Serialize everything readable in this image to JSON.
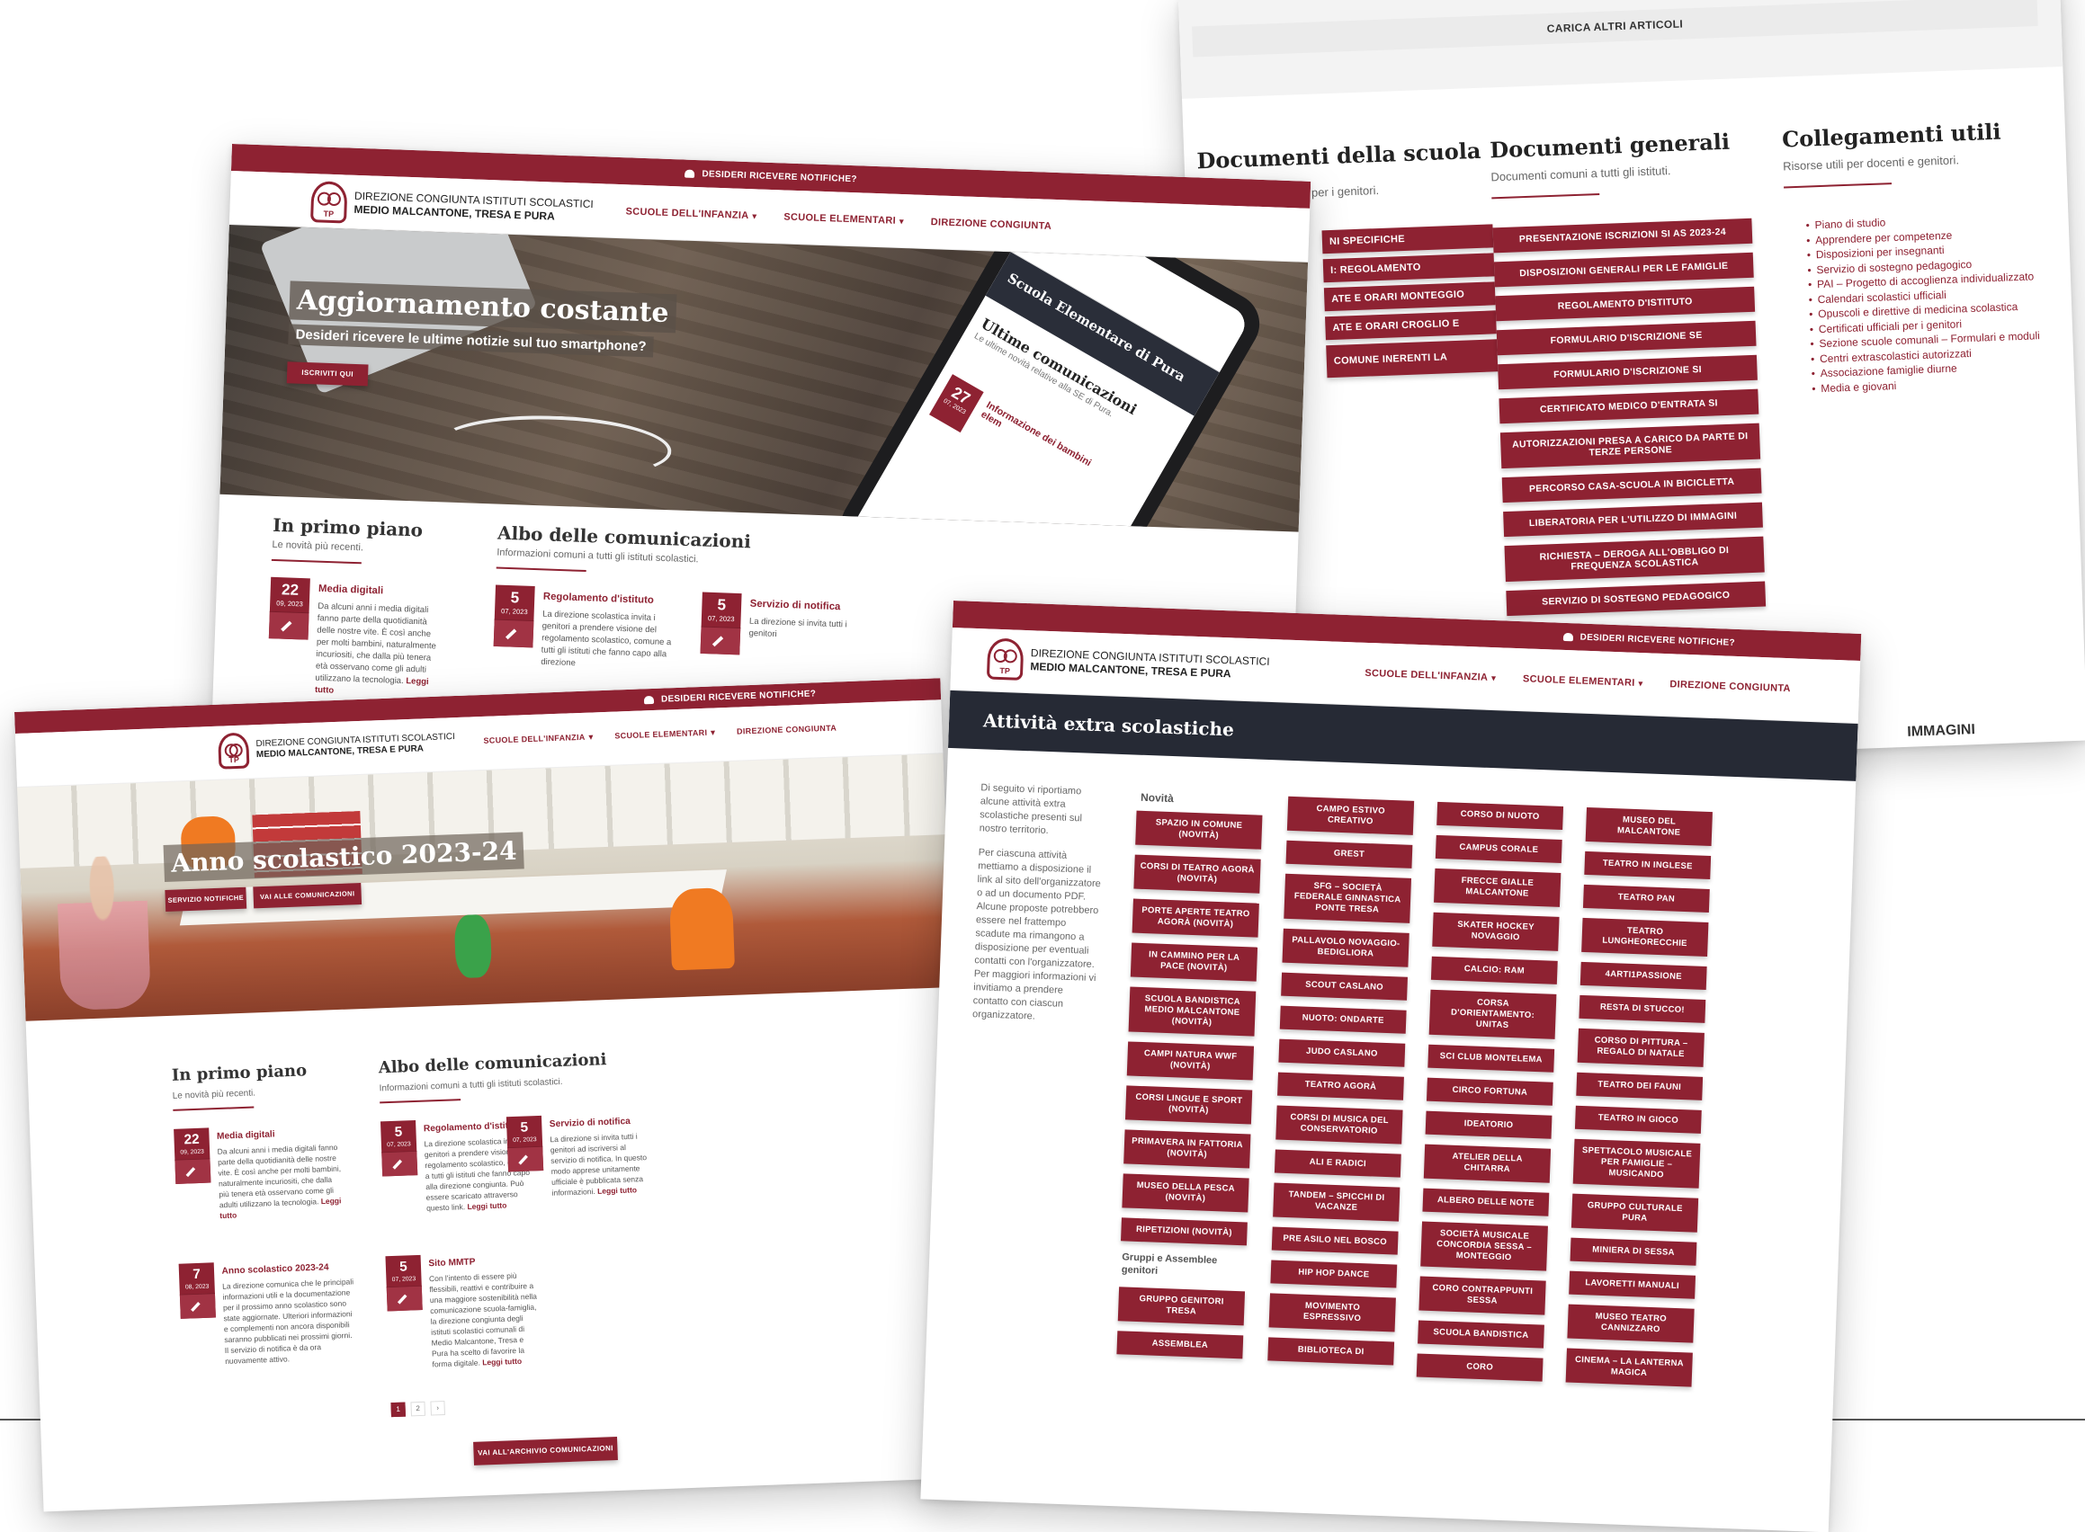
{
  "common": {
    "notify_bar": "DESIDERI RICEVERE NOTIFICHE?",
    "logo_line1": "DIREZIONE CONGIUNTA ISTITUTI SCOLASTICI",
    "logo_line2": "MEDIO MALCANTONE, TRESA E PURA",
    "logo_badge_top": "MM",
    "logo_badge_bottom": "TP",
    "nav": [
      "SCUOLE DELL'INFANZIA",
      "SCUOLE ELEMENTARI",
      "DIREZIONE CONGIUNTA"
    ],
    "chevron": "⌄",
    "brand_color": "#8e2232",
    "dark_header_color": "#262a35"
  },
  "documents_page": {
    "load_more": "CARICA ALTRI ARTICOLI",
    "school_docs": {
      "title": "Documenti della scuola",
      "subtitle": "per i genitori.",
      "buttons": [
        "NI SPECIFICHE",
        "I: REGOLAMENTO",
        "ATE E ORARI MONTEGGIO",
        "ATE E ORARI CROGLIO E",
        "COMUNE INERENTI LA"
      ]
    },
    "general_docs": {
      "title": "Documenti generali",
      "subtitle": "Documenti comuni a tutti gli istituti.",
      "buttons": [
        "PRESENTAZIONE ISCRIZIONI SI AS 2023-24",
        "DISPOSIZIONI GENERALI PER LE FAMIGLIE",
        "REGOLAMENTO D'ISTITUTO",
        "FORMULARIO D'ISCRIZIONE SE",
        "FORMULARIO D'ISCRIZIONE SI",
        "CERTIFICATO MEDICO D'ENTRATA SI",
        "AUTORIZZAZIONI PRESA A CARICO DA PARTE DI TERZE PERSONE",
        "PERCORSO CASA-SCUOLA IN BICICLETTA",
        "LIBERATORIA PER L'UTILIZZO DI IMMAGINI",
        "RICHIESTA – DEROGA ALL'OBBLIGO DI FREQUENZA SCOLASTICA",
        "SERVIZIO DI SOSTEGNO PEDAGOGICO"
      ]
    },
    "useful_links": {
      "title": "Collegamenti utili",
      "subtitle": "Risorse utili per docenti e genitori.",
      "items": [
        "Piano di studio",
        "Apprendere per competenze",
        "Disposizioni per insegnanti",
        "Servizio di sostegno pedagogico",
        "PAI – Progetto di accoglienza individualizzato",
        "Calendari scolastici ufficiali",
        "Opuscoli e direttive di medicina scolastica",
        "Certificati ufficiali per i genitori",
        "Sezione scuole comunali – Formulari e moduli",
        "Centri extrascolastici autorizzati",
        "Associazione famiglie diurne",
        "Media e giovani"
      ]
    },
    "images_label": "IMMAGINI"
  },
  "home_top": {
    "hero_title": "Aggiornamento costante",
    "hero_subtitle": "Desideri ricevere le ultime notizie sul tuo smartphone?",
    "hero_button": "ISCRIVITI QUI",
    "phone": {
      "school": "Scuola Elementare di Pura",
      "heading": "Ultime comunicazioni",
      "sub": "Le ultime novità relative alla SE di Pura.",
      "day": "27",
      "month": "07, 2023",
      "item": "Informazione dei bambini elem"
    },
    "primo_piano": {
      "title": "In primo piano",
      "subtitle": "Le novità più recenti."
    },
    "albo": {
      "title": "Albo delle comunicazioni",
      "subtitle": "Informazioni comuni a tutti gli istituti scolastici."
    },
    "news": [
      {
        "day": "22",
        "month": "09, 2023",
        "title": "Media digitali",
        "body": "Da alcuni anni i media digitali fanno parte della quotidianità delle nostre vite. È così anche per molti bambini, naturalmente incuriositi, che dalla più tenera età osservano come gli adulti utilizzano la tecnologia.",
        "more": "Leggi tutto"
      },
      {
        "day": "5",
        "month": "07, 2023",
        "title": "Regolamento d'istituto",
        "body": "La direzione scolastica invita i genitori a prendere visione del regolamento scolastico, comune a tutti gli istituti che fanno capo alla direzione",
        "more": ""
      },
      {
        "day": "5",
        "month": "07, 2023",
        "title": "Servizio di notifica",
        "body": "La direzione si invita tutti i genitori",
        "more": ""
      }
    ]
  },
  "home_bottom": {
    "hero_title": "Anno scolastico 2023-24",
    "buttons": [
      "SERVIZIO NOTIFICHE",
      "VAI ALLE COMUNICAZIONI"
    ],
    "primo_piano": {
      "title": "In primo piano",
      "subtitle": "Le novità più recenti."
    },
    "albo": {
      "title": "Albo delle comunicazioni",
      "subtitle": "Informazioni comuni a tutti gli istituti scolastici."
    },
    "left_news": [
      {
        "day": "22",
        "month": "09, 2023",
        "title": "Media digitali",
        "body": "Da alcuni anni i media digitali fanno parte della quotidianità delle nostre vite. È così anche per molti bambini, naturalmente incuriositi, che dalla più tenera età osservano come gli adulti utilizzano la tecnologia.",
        "more": "Leggi tutto"
      },
      {
        "day": "7",
        "month": "08, 2023",
        "title": "Anno scolastico 2023-24",
        "body": "La direzione comunica che le principali informazioni utili e la documentazione per il prossimo anno scolastico sono state aggiornate. Ulteriori informazioni e complementi non ancora disponibili saranno pubblicati nei prossimi giorni. Il servizio di notifica è da ora nuovamente attivo.",
        "more": ""
      }
    ],
    "right_news": [
      {
        "day": "5",
        "month": "07, 2023",
        "title": "Regolamento d'istituto",
        "body": "La direzione scolastica invita i genitori a prendere visione del regolamento scolastico, comune a tutti gli istituti che fanno capo alla direzione congiunta. Può essere scaricato attraverso questo link.",
        "more": "Leggi tutto"
      },
      {
        "day": "5",
        "month": "07, 2023",
        "title": "Servizio di notifica",
        "body": "La direzione si invita tutti i genitori ad iscriversi al servizio di notifica. In questo modo apprese unitamente ufficiale è pubblicata senza informazioni.",
        "more": "Leggi tutto"
      },
      {
        "day": "5",
        "month": "07, 2023",
        "title": "Sito MMTP",
        "body": "Con l'intento di essere più flessibili, reattivi e contribuire a una maggiore sostenibilità nella comunicazione scuola-famiglia, la direzione congiunta degli istituti scolastici comunali di Medio Malcantone, Tresa e Pura ha scelto di favorire la forma digitale.",
        "more": "Leggi tutto"
      }
    ],
    "pager": [
      "1",
      "2",
      "›"
    ],
    "archive_button": "VAI ALL'ARCHIVIO COMUNICAZIONI"
  },
  "activities_page": {
    "title": "Attività extra scolastiche",
    "intro_1": "Di seguito vi riportiamo alcune attività extra scolastiche presenti sul nostro territorio.",
    "intro_2": "Per ciascuna attività mettiamo a disposizione il link al sito dell'organizzatore o ad un documento PDF. Alcune proposte potrebbero essere nel frattempo scadute ma rimangono a disposizione per eventuali contatti con l'organizzatore. Per maggiori informazioni vi invitiamo a prendere contatto con ciascun organizzatore.",
    "novita_label": "Novità",
    "groups_label": "Gruppi e Assemblee genitori",
    "col1": [
      "SPAZIO IN COMUNE (NOVITÀ)",
      "CORSI DI TEATRO AGORÀ (NOVITÀ)",
      "PORTE APERTE TEATRO AGORÀ (NOVITÀ)",
      "IN CAMMINO PER LA PACE (NOVITÀ)",
      "SCUOLA BANDISTICA MEDIO MALCANTONE (NOVITÀ)",
      "CAMPI NATURA WWF (NOVITÀ)",
      "CORSI LINGUE E SPORT (NOVITÀ)",
      "PRIMAVERA IN FATTORIA (NOVITÀ)",
      "MUSEO DELLA PESCA (NOVITÀ)",
      "RIPETIZIONI (NOVITÀ)"
    ],
    "col1_groups": [
      "GRUPPO GENITORI TRESA",
      "ASSEMBLEA"
    ],
    "col2": [
      "CAMPO ESTIVO CREATIVO",
      "GREST",
      "SFG – SOCIETÀ FEDERALE GINNASTICA PONTE TRESA",
      "PALLAVOLO NOVAGGIO-BEDIGLIORA",
      "SCOUT CASLANO",
      "NUOTO: ONDARTE",
      "JUDO CASLANO",
      "TEATRO AGORÀ",
      "CORSI DI MUSICA DEL CONSERVATORIO",
      "ALI E RADICI",
      "TANDEM – SPICCHI DI VACANZE",
      "PRE ASILO NEL BOSCO",
      "HIP HOP DANCE",
      "MOVIMENTO ESPRESSIVO",
      "BIBLIOTECA DI"
    ],
    "col3": [
      "CORSO DI NUOTO",
      "CAMPUS CORALE",
      "FRECCE GIALLE MALCANTONE",
      "SKATER HOCKEY NOVAGGIO",
      "CALCIO: RAM",
      "CORSA D'ORIENTAMENTO: UNITAS",
      "SCI CLUB MONTELEMA",
      "CIRCO FORTUNA",
      "IDEATORIO",
      "ATELIER DELLA CHITARRA",
      "ALBERO DELLE NOTE",
      "SOCIETÀ MUSICALE CONCORDIA SESSA – MONTEGGIO",
      "CORO CONTRAPPUNTI SESSA",
      "SCUOLA BANDISTICA",
      "CORO"
    ],
    "col4": [
      "MUSEO DEL MALCANTONE",
      "TEATRO IN INGLESE",
      "TEATRO PAN",
      "TEATRO LUNGHEORECCHIE",
      "4ARTI1PASSIONE",
      "RESTA DI STUCCO!",
      "CORSO DI PITTURA – REGALO DI NATALE",
      "TEATRO DEI FAUNI",
      "TEATRO IN GIOCO",
      "SPETTACOLO MUSICALE PER FAMIGLIE – MUSICANDO",
      "GRUPPO CULTURALE PURA",
      "MINIERA DI SESSA",
      "LAVORETTI MANUALI",
      "MUSEO TEATRO CANNIZZARO",
      "CINEMA – LA LANTERNA MAGICA"
    ]
  }
}
